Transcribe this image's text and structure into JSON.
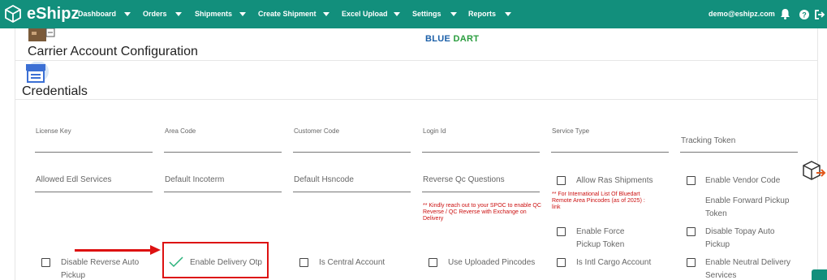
{
  "navbar": {
    "brand": "eShipz",
    "items": [
      {
        "label": "Dashboard"
      },
      {
        "label": "Orders"
      },
      {
        "label": "Shipments"
      },
      {
        "label": "Create Shipment"
      },
      {
        "label": "Excel Upload"
      },
      {
        "label": "Settings"
      },
      {
        "label": "Reports"
      }
    ],
    "user_email": "demo@eshipz.com",
    "icons": [
      "bell-icon",
      "help-icon",
      "logout-icon"
    ],
    "bg_color": "#128f7c"
  },
  "carrier": {
    "section_title": "Carrier Account Configuration",
    "logo_part1": "BLUE",
    "logo_part2": "DART"
  },
  "credentials": {
    "section_title": "Credentials",
    "row1": [
      {
        "label": "License Key"
      },
      {
        "label": "Area Code"
      },
      {
        "label": "Customer Code"
      },
      {
        "label": "Login Id"
      },
      {
        "label": "Service Type"
      },
      {
        "label": "Tracking Token"
      }
    ],
    "row2": [
      {
        "label": "Allowed Edl Services"
      },
      {
        "label": "Default Incoterm"
      },
      {
        "label": "Default Hsncode"
      },
      {
        "label": "Reverse Qc Questions"
      }
    ],
    "reverse_qc_note": "** Kindly reach out to your SPOC to enable QC Reverse / QC Reverse with Exchange on Delivery",
    "ras_note": "** For International List Of Bluedart Remote Area Pincodes (as of 2025) : link",
    "checkboxes": {
      "allow_ras_shipments": {
        "label": "Allow Ras Shipments",
        "checked": false
      },
      "enable_vendor_code": {
        "label": "Enable Vendor Code",
        "checked": false
      },
      "enable_forward_pickup_token": {
        "label": "Enable Forward Pickup Token",
        "checked": false
      },
      "enable_force_pickup_token": {
        "label": "Enable Force Pickup Token",
        "checked": false
      },
      "disable_topay_auto_pickup": {
        "label": "Disable Topay Auto Pickup",
        "checked": false
      },
      "disable_reverse_auto_pickup": {
        "label": "Disable Reverse Auto Pickup",
        "checked": false
      },
      "enable_delivery_otp": {
        "label": "Enable Delivery Otp",
        "checked": true
      },
      "is_central_account": {
        "label": "Is Central Account",
        "checked": false
      },
      "use_uploaded_pincodes": {
        "label": "Use Uploaded Pincodes",
        "checked": false
      },
      "is_intl_cargo_account": {
        "label": "Is Intl Cargo Account",
        "checked": false
      },
      "enable_neutral_delivery_services": {
        "label": "Enable Neutral Delivery Services",
        "checked": false
      }
    }
  },
  "colors": {
    "accent": "#128f7c",
    "highlight": "#dd1111",
    "check_mark": "#2ab27b"
  }
}
